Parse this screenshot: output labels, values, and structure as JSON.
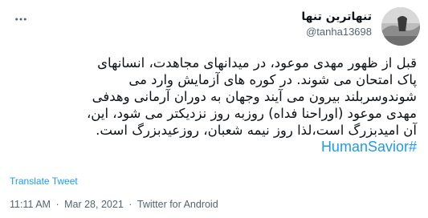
{
  "author": {
    "display_name": "تنهاترین تنها",
    "handle": "@tanha13698"
  },
  "tweet": {
    "lines": [
      "قبل از ظهور مهدی موعود، در میدانهای مجاهدت، انسانهای",
      "پاک امتحان می شوند. در کوره های آزمایش وارد می",
      "شوندوسربلند بیرون می آیند وجهان به دوران آرمانی وهدفی",
      "مهدی موعود (اوراحنا فداه) روزبه روز نزدیکتر می شود، این،",
      "آن امیدبزرگ است،لذا روز نیمه شعبان، روزعیدبزرگ است."
    ],
    "hashtag": "#HumanSavior"
  },
  "translate_label": "Translate Tweet",
  "meta": {
    "time": "11:11 AM",
    "separator": "·",
    "date": "Mar 28, 2021",
    "source": "Twitter for Android"
  },
  "icons": {
    "more": "more-horizontal-icon"
  },
  "colors": {
    "link": "#1d9bf0",
    "secondary_text": "#536471",
    "primary_text": "#0f1419"
  }
}
